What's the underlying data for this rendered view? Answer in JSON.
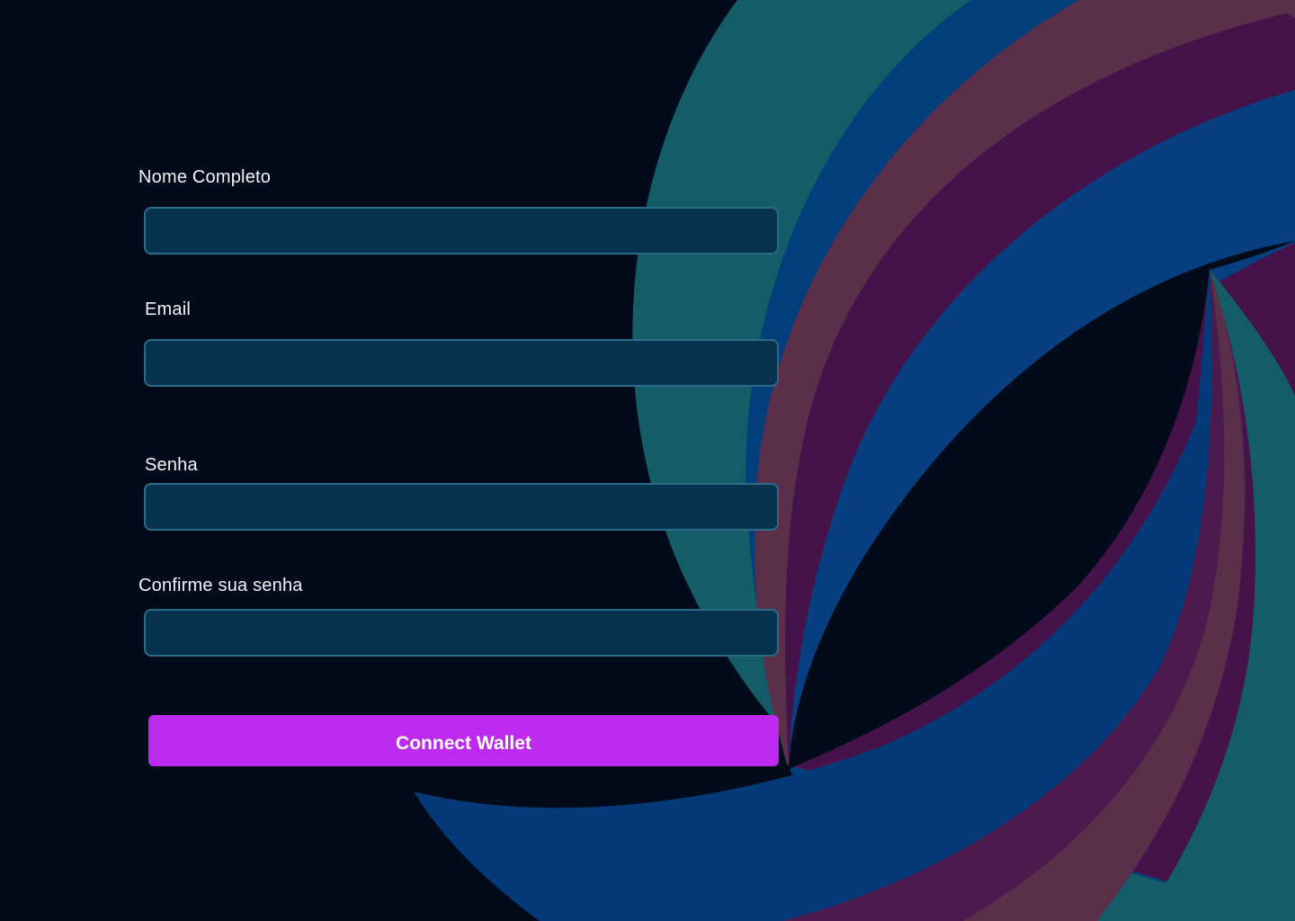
{
  "form": {
    "fields": [
      {
        "label": "Nome Completo",
        "value": "",
        "placeholder": ""
      },
      {
        "label": "Email",
        "value": "",
        "placeholder": ""
      },
      {
        "label": "Senha",
        "value": "",
        "placeholder": ""
      },
      {
        "label": "Confirme sua senha",
        "value": "",
        "placeholder": ""
      }
    ],
    "submit_label": "Connect Wallet"
  },
  "colors": {
    "background": "#020b19",
    "input_fill": "#07334f",
    "input_border": "#2a6b8a",
    "button": "#bc2aee",
    "swirl_teal": "#145c68",
    "swirl_blue": "#033e7c",
    "swirl_rose": "#5a2f4a",
    "swirl_purple": "#45124a"
  }
}
